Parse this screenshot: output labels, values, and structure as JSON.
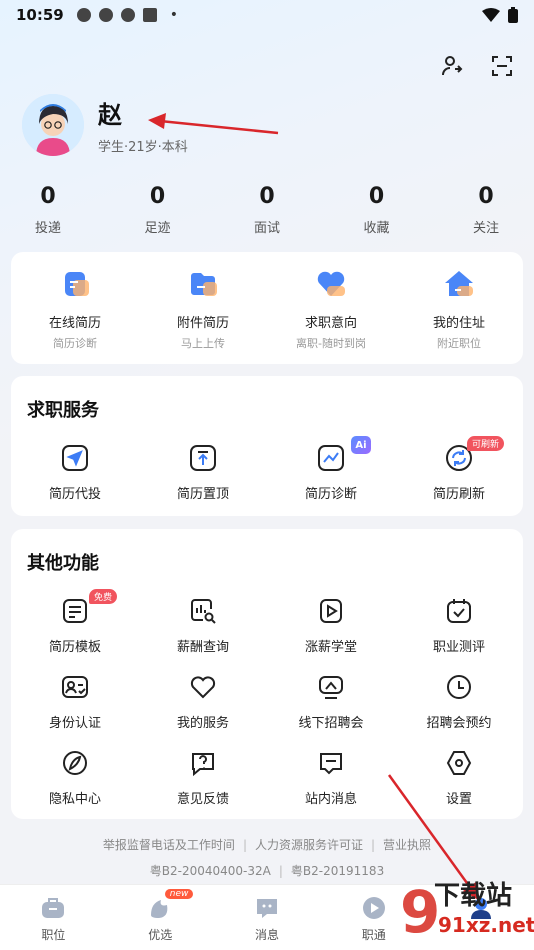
{
  "status_bar": {
    "time": "10:59",
    "dot": "•"
  },
  "profile": {
    "name": "赵",
    "subtitle": "学生·21岁·本科"
  },
  "stats": [
    {
      "value": "0",
      "label": "投递"
    },
    {
      "value": "0",
      "label": "足迹"
    },
    {
      "value": "0",
      "label": "面试"
    },
    {
      "value": "0",
      "label": "收藏"
    },
    {
      "value": "0",
      "label": "关注"
    }
  ],
  "quick": [
    {
      "label": "在线简历",
      "sub": "简历诊断",
      "icon": "online-resume-icon"
    },
    {
      "label": "附件简历",
      "sub": "马上上传",
      "icon": "attachment-resume-icon"
    },
    {
      "label": "求职意向",
      "sub": "离职-随时到岗",
      "icon": "job-intention-icon"
    },
    {
      "label": "我的住址",
      "sub": "附近职位",
      "icon": "home-address-icon"
    }
  ],
  "service": {
    "title": "求职服务",
    "items": [
      {
        "label": "简历代投",
        "icon": "send-icon"
      },
      {
        "label": "简历置顶",
        "icon": "pin-top-icon"
      },
      {
        "label": "简历诊断",
        "icon": "diagnose-icon",
        "badge": "Ai"
      },
      {
        "label": "简历刷新",
        "icon": "refresh-icon",
        "badge": "可刷新"
      }
    ]
  },
  "other": {
    "title": "其他功能",
    "items": [
      {
        "label": "简历模板",
        "icon": "resume-template-icon",
        "badge": "免费"
      },
      {
        "label": "薪酬查询",
        "icon": "salary-search-icon"
      },
      {
        "label": "涨薪学堂",
        "icon": "video-class-icon"
      },
      {
        "label": "职业测评",
        "icon": "career-test-icon"
      },
      {
        "label": "身份认证",
        "icon": "id-verify-icon"
      },
      {
        "label": "我的服务",
        "icon": "heart-icon"
      },
      {
        "label": "线下招聘会",
        "icon": "offline-fair-icon"
      },
      {
        "label": "招聘会预约",
        "icon": "clock-icon"
      },
      {
        "label": "隐私中心",
        "icon": "privacy-icon"
      },
      {
        "label": "意见反馈",
        "icon": "feedback-icon"
      },
      {
        "label": "站内消息",
        "icon": "message-icon"
      },
      {
        "label": "设置",
        "icon": "settings-icon"
      }
    ]
  },
  "footer": {
    "links": [
      "举报监督电话及工作时间",
      "人力资源服务许可证",
      "营业执照"
    ],
    "reg1": "粤B2-20040400-32A",
    "reg2": "粤B2-20191183"
  },
  "tabbar": [
    {
      "label": "职位",
      "icon": "briefcase-icon"
    },
    {
      "label": "优选",
      "icon": "preferred-icon",
      "badge": "new"
    },
    {
      "label": "消息",
      "icon": "chat-icon"
    },
    {
      "label": "职通",
      "icon": "play-icon"
    },
    {
      "label": "",
      "icon": "profile-tab-icon"
    }
  ],
  "watermark": {
    "text": "下载站",
    "site": "91xz.net"
  },
  "colors": {
    "accent": "#3c7cf5",
    "badge_red": "#f1545e",
    "arrow_red": "#d9262b"
  }
}
